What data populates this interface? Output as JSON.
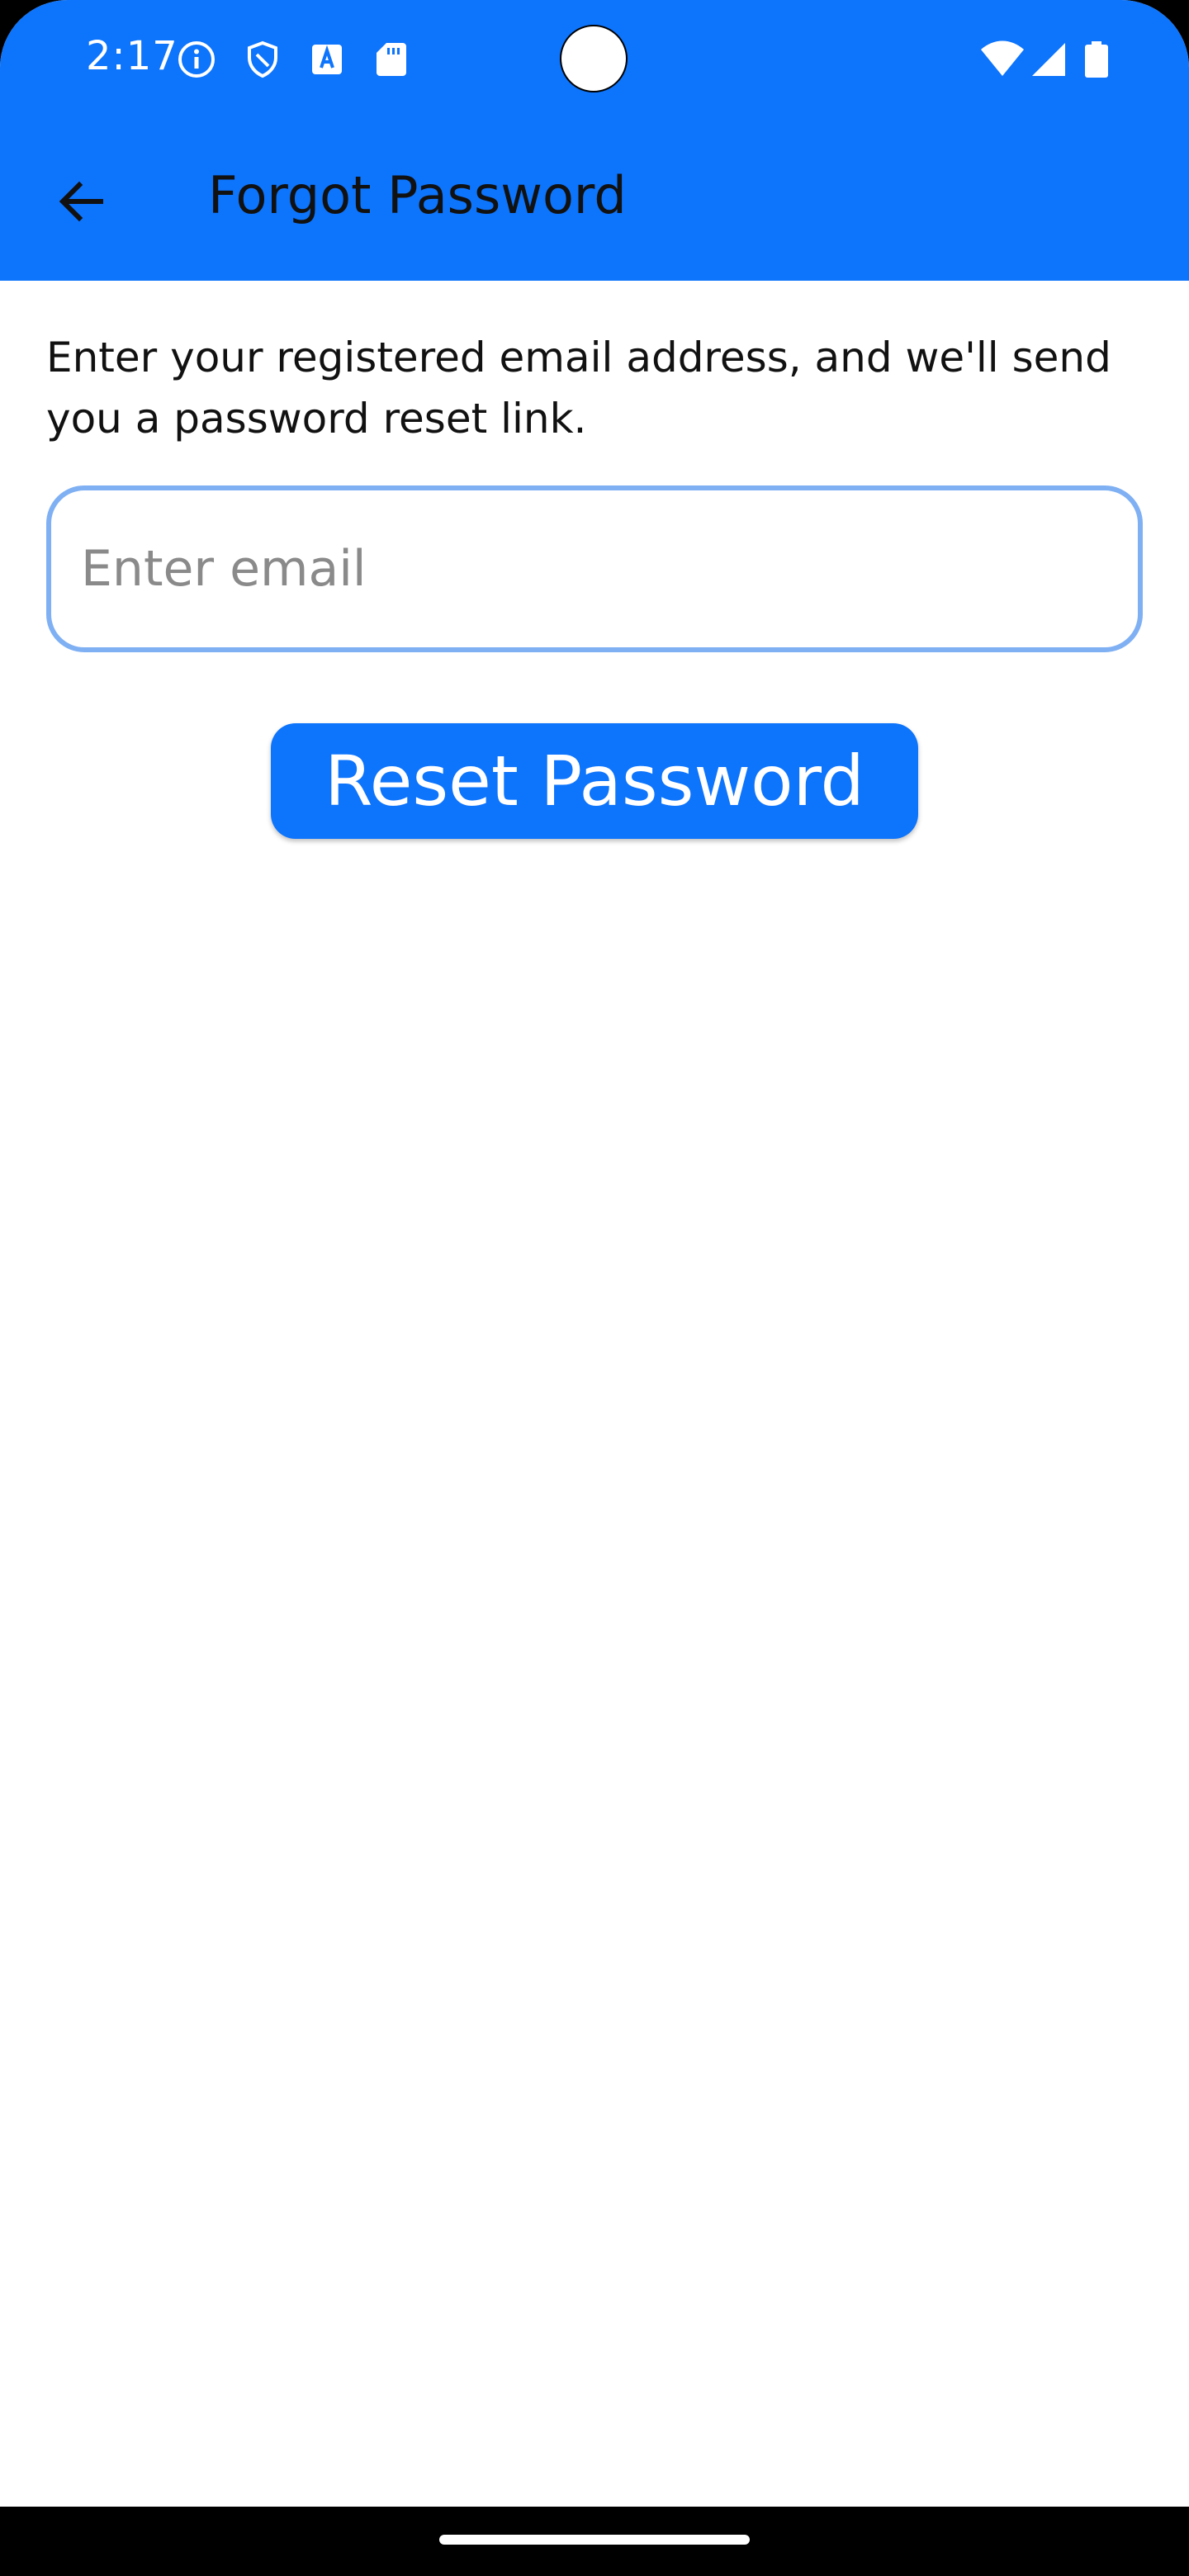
{
  "status_bar": {
    "time": "2:17",
    "icons": [
      "info-icon",
      "shield-icon",
      "font-a-icon",
      "sd-card-icon",
      "wifi-icon",
      "signal-icon",
      "battery-icon"
    ]
  },
  "app_bar": {
    "back_icon": "arrow-back-icon",
    "title": "Forgot Password"
  },
  "main": {
    "instructions": "Enter your registered email address, and we'll send you a password reset link.",
    "email_input": {
      "value": "",
      "placeholder": "Enter email"
    },
    "reset_button_label": "Reset Password"
  },
  "colors": {
    "primary": "#0d74fc",
    "input_border": "#7fb0f3",
    "text": "#111111",
    "placeholder": "#8a8a8a"
  }
}
